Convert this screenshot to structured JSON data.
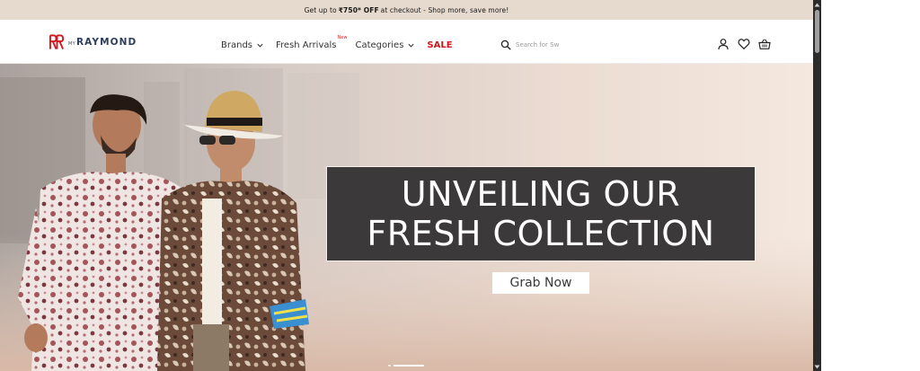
{
  "announcement": {
    "prefix": "Get up to",
    "highlight": "₹750* OFF",
    "suffix": "at checkout - Shop more, save more!"
  },
  "header": {
    "logo": {
      "prefix": "MY",
      "name": "RAYMOND",
      "mark_color": "#d0161f",
      "text_color": "#2c3e5c"
    },
    "nav": [
      {
        "label": "Brands",
        "has_dropdown": true
      },
      {
        "label": "Fresh Arrivals",
        "badge": "New"
      },
      {
        "label": "Categories",
        "has_dropdown": true
      },
      {
        "label": "SALE",
        "accent": "#d0161f"
      }
    ],
    "search": {
      "placeholder": "Search for Sw",
      "value": ""
    },
    "icons": [
      "user-icon",
      "heart-icon",
      "basket-icon"
    ]
  },
  "hero": {
    "headline": [
      "UNVEILING OUR",
      "FRESH COLLECTION"
    ],
    "cta_label": "Grab Now",
    "carousel": {
      "slides": 2,
      "active": 1
    }
  },
  "colors": {
    "announcement_bg": "#e6d9cd",
    "headline_box": "#3b3939",
    "sale_red": "#d0161f"
  }
}
